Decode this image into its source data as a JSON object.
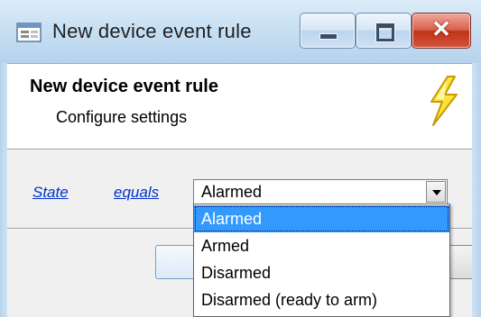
{
  "window": {
    "title": "New device event rule",
    "icon": "app-form-icon",
    "controls": [
      "minimize-icon",
      "maximize-icon",
      "close-icon"
    ],
    "close_glyph": "✕"
  },
  "header": {
    "title": "New device event rule",
    "subtitle": "Configure settings",
    "icon": "lightning-bolt-icon"
  },
  "rule": {
    "field_link": "State",
    "operator_link": "equals",
    "value": "Alarmed"
  },
  "dropdown": {
    "options": [
      "Alarmed",
      "Armed",
      "Disarmed",
      "Disarmed (ready to arm)"
    ],
    "selected_index": 0
  },
  "colors": {
    "link": "#0033cc",
    "selection": "#3399ff",
    "close_button": "#c8412a"
  }
}
